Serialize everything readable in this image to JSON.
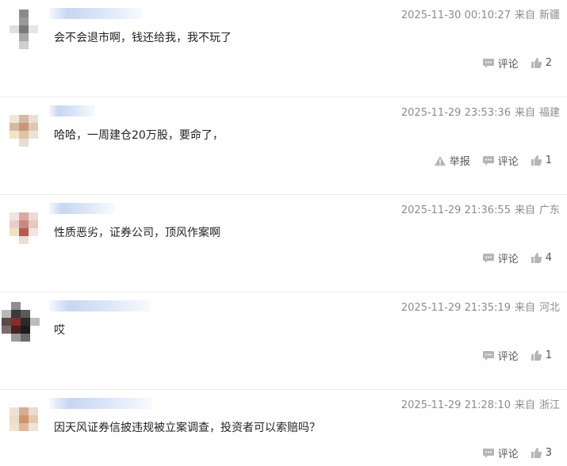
{
  "labels": {
    "report": "举报",
    "comment": "评论"
  },
  "colors": {
    "icon": "#b5b5b5",
    "meta_text": "#8c8c8c",
    "divider": "#e8e8e8",
    "username_blur": "#c7d6f3"
  },
  "comments": [
    {
      "time": "2025-11-30 00:10:27",
      "source": "来自",
      "location": "新疆",
      "text": "会不会退市啊，钱还给我，我不玩了",
      "likes": "2",
      "has_report": false
    },
    {
      "time": "2025-11-29 23:53:36",
      "source": "来自",
      "location": "福建",
      "text": "哈哈，一周建仓20万股，要命了，",
      "likes": "1",
      "has_report": true
    },
    {
      "time": "2025-11-29 21:36:55",
      "source": "来自",
      "location": "广东",
      "text": "性质恶劣，证券公司，顶风作案啊",
      "likes": "4",
      "has_report": false
    },
    {
      "time": "2025-11-29 21:35:19",
      "source": "来自",
      "location": "河北",
      "text": "哎",
      "likes": "1",
      "has_report": false
    },
    {
      "time": "2025-11-29 21:28:10",
      "source": "来自",
      "location": "浙江",
      "text": "因天风证券信披违规被立案调查，投资者可以索赔吗？",
      "likes": "3",
      "has_report": false
    }
  ]
}
